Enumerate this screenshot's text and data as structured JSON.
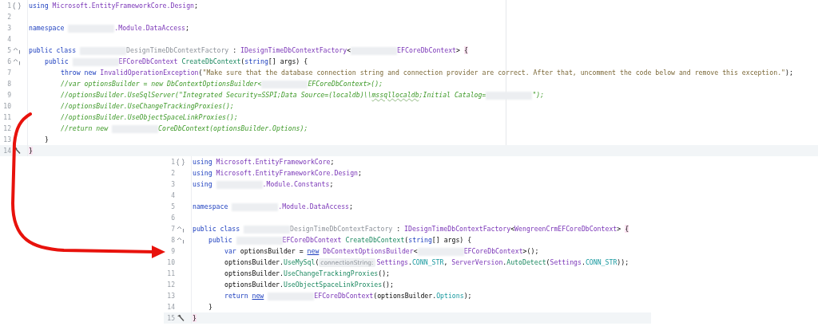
{
  "editors": [
    {
      "lines": [
        {
          "number": "1",
          "current": false,
          "kind": "braces",
          "tokens": [
            {
              "kind": "k",
              "text": "using "
            },
            {
              "kind": "t",
              "text": "Microsoft.EntityFrameworkCore.Design"
            },
            {
              "kind": "p",
              "text": ";"
            }
          ]
        },
        {
          "number": "2",
          "current": false
        },
        {
          "number": "3",
          "current": false,
          "tokens": [
            {
              "kind": "k",
              "text": "namespace "
            },
            {
              "kind": "r"
            },
            {
              "kind": "t",
              "text": ".Module.DataAccess"
            },
            {
              "kind": "p",
              "text": ";"
            }
          ]
        },
        {
          "number": "4",
          "current": false
        },
        {
          "number": "5",
          "current": false,
          "kind": "override",
          "tokens": [
            {
              "kind": "k",
              "text": "public class "
            },
            {
              "kind": "r"
            },
            {
              "kind": "g",
              "text": "DesignTimeDbContextFactory"
            },
            {
              "kind": "p",
              "text": " : "
            },
            {
              "kind": "t",
              "text": "IDesignTimeDbContextFactory"
            },
            {
              "kind": "p",
              "text": "<"
            },
            {
              "kind": "r"
            },
            {
              "kind": "t",
              "text": "EFCoreDbContext"
            },
            {
              "kind": "p",
              "text": "> "
            },
            {
              "kind": "b",
              "text": "{"
            }
          ]
        },
        {
          "number": "6",
          "current": false,
          "kind": "override",
          "tokens": [
            {
              "kind": "i"
            },
            {
              "kind": "k",
              "text": "public "
            },
            {
              "kind": "r"
            },
            {
              "kind": "t",
              "text": "EFCoreDbContext "
            },
            {
              "kind": "m",
              "text": "CreateDbContext"
            },
            {
              "kind": "p",
              "text": "("
            },
            {
              "kind": "k",
              "text": "string"
            },
            {
              "kind": "p",
              "text": "[] args) {"
            }
          ]
        },
        {
          "number": "7",
          "current": false,
          "tokens": [
            {
              "kind": "i"
            },
            {
              "kind": "i"
            },
            {
              "kind": "k",
              "text": "throw new "
            },
            {
              "kind": "t",
              "text": "InvalidOperationException"
            },
            {
              "kind": "p",
              "text": "("
            },
            {
              "kind": "s",
              "text": "\"Make sure that the database connection string and connection provider are correct. After that, uncomment the code below and remove this exception.\""
            },
            {
              "kind": "p",
              "text": ");"
            }
          ]
        },
        {
          "number": "8",
          "current": false,
          "tokens": [
            {
              "kind": "i"
            },
            {
              "kind": "i"
            },
            {
              "kind": "c",
              "text": "//var optionsBuilder = new DbContextOptionsBuilder<"
            },
            {
              "kind": "r"
            },
            {
              "kind": "c",
              "text": "EFCoreDbContext>();"
            }
          ]
        },
        {
          "number": "9",
          "current": false,
          "tokens": [
            {
              "kind": "i"
            },
            {
              "kind": "i"
            },
            {
              "kind": "c",
              "text": "//optionsBuilder.UseSqlServer(\"Integrated Security=SSPI;Data Source=(localdb)\\\\"
            },
            {
              "kind": "cs",
              "text": "mssqllocaldb"
            },
            {
              "kind": "c",
              "text": ";Initial Catalog="
            },
            {
              "kind": "r"
            },
            {
              "kind": "c",
              "text": "\");"
            }
          ]
        },
        {
          "number": "10",
          "current": false,
          "tokens": [
            {
              "kind": "i"
            },
            {
              "kind": "i"
            },
            {
              "kind": "c",
              "text": "//optionsBuilder.UseChangeTrackingProxies();"
            }
          ]
        },
        {
          "number": "11",
          "current": false,
          "tokens": [
            {
              "kind": "i"
            },
            {
              "kind": "i"
            },
            {
              "kind": "c",
              "text": "//optionsBuilder.UseObjectSpaceLinkProxies();"
            }
          ]
        },
        {
          "number": "12",
          "current": false,
          "tokens": [
            {
              "kind": "i"
            },
            {
              "kind": "i"
            },
            {
              "kind": "c",
              "text": "//return new "
            },
            {
              "kind": "r"
            },
            {
              "kind": "c",
              "text": "CoreDbContext(optionsBuilder.Options);"
            }
          ]
        },
        {
          "number": "13",
          "current": false,
          "tokens": [
            {
              "kind": "i"
            },
            {
              "kind": "p",
              "text": "}"
            }
          ]
        },
        {
          "number": "14",
          "current": true,
          "kind": "hammer",
          "tokens": [
            {
              "kind": "b",
              "text": "}"
            }
          ]
        }
      ]
    },
    {
      "lines": [
        {
          "number": "1",
          "current": false,
          "kind": "braces",
          "tokens": [
            {
              "kind": "k",
              "text": "using "
            },
            {
              "kind": "t",
              "text": "Microsoft.EntityFrameworkCore"
            },
            {
              "kind": "p",
              "text": ";"
            }
          ]
        },
        {
          "number": "2",
          "current": false,
          "tokens": [
            {
              "kind": "k",
              "text": "using "
            },
            {
              "kind": "t",
              "text": "Microsoft.EntityFrameworkCore.Design"
            },
            {
              "kind": "p",
              "text": ";"
            }
          ]
        },
        {
          "number": "3",
          "current": false,
          "tokens": [
            {
              "kind": "k",
              "text": "using "
            },
            {
              "kind": "r"
            },
            {
              "kind": "t",
              "text": ".Module.Constants"
            },
            {
              "kind": "p",
              "text": ";"
            }
          ]
        },
        {
          "number": "4",
          "current": false
        },
        {
          "number": "5",
          "current": false,
          "tokens": [
            {
              "kind": "k",
              "text": "namespace "
            },
            {
              "kind": "r"
            },
            {
              "kind": "t",
              "text": ".Module.DataAccess"
            },
            {
              "kind": "p",
              "text": ";"
            }
          ]
        },
        {
          "number": "6",
          "current": false
        },
        {
          "number": "7",
          "current": false,
          "kind": "override",
          "tokens": [
            {
              "kind": "k",
              "text": "public class "
            },
            {
              "kind": "r"
            },
            {
              "kind": "g",
              "text": "DesignTimeDbContextFactory"
            },
            {
              "kind": "p",
              "text": " : "
            },
            {
              "kind": "t",
              "text": "IDesignTimeDbContextFactory"
            },
            {
              "kind": "p",
              "text": "<"
            },
            {
              "kind": "t",
              "text": "WengreenCrmEFCoreDbContext"
            },
            {
              "kind": "p",
              "text": "> "
            },
            {
              "kind": "b",
              "text": "{"
            }
          ]
        },
        {
          "number": "8",
          "current": false,
          "kind": "override",
          "tokens": [
            {
              "kind": "i"
            },
            {
              "kind": "k",
              "text": "public "
            },
            {
              "kind": "r"
            },
            {
              "kind": "t",
              "text": "EFCoreDbContext "
            },
            {
              "kind": "m",
              "text": "CreateDbContext"
            },
            {
              "kind": "p",
              "text": "("
            },
            {
              "kind": "k",
              "text": "string"
            },
            {
              "kind": "p",
              "text": "[] args) {"
            }
          ]
        },
        {
          "number": "9",
          "current": false,
          "tokens": [
            {
              "kind": "i"
            },
            {
              "kind": "i"
            },
            {
              "kind": "k",
              "text": "var "
            },
            {
              "kind": "p",
              "text": "optionsBuilder = "
            },
            {
              "kind": "u",
              "text": "new"
            },
            {
              "kind": "sp"
            },
            {
              "kind": "t",
              "text": "DbContextOptionsBuilder"
            },
            {
              "kind": "p",
              "text": "<"
            },
            {
              "kind": "r"
            },
            {
              "kind": "t",
              "text": "EFCoreDbContext"
            },
            {
              "kind": "p",
              "text": ">();"
            }
          ]
        },
        {
          "number": "10",
          "current": false,
          "tokens": [
            {
              "kind": "i"
            },
            {
              "kind": "i"
            },
            {
              "kind": "p",
              "text": "optionsBuilder."
            },
            {
              "kind": "m",
              "text": "UseMySql"
            },
            {
              "kind": "p",
              "text": "("
            },
            {
              "kind": "h",
              "text": "connectionString:"
            },
            {
              "kind": "t",
              "text": "Settings"
            },
            {
              "kind": "p",
              "text": "."
            },
            {
              "kind": "f",
              "text": "CONN_STR"
            },
            {
              "kind": "p",
              "text": ", "
            },
            {
              "kind": "t",
              "text": "ServerVersion"
            },
            {
              "kind": "p",
              "text": "."
            },
            {
              "kind": "m",
              "text": "AutoDetect"
            },
            {
              "kind": "p",
              "text": "("
            },
            {
              "kind": "t",
              "text": "Settings"
            },
            {
              "kind": "p",
              "text": "."
            },
            {
              "kind": "f",
              "text": "CONN_STR"
            },
            {
              "kind": "p",
              "text": "));"
            }
          ]
        },
        {
          "number": "11",
          "current": false,
          "tokens": [
            {
              "kind": "i"
            },
            {
              "kind": "i"
            },
            {
              "kind": "p",
              "text": "optionsBuilder."
            },
            {
              "kind": "m",
              "text": "UseChangeTrackingProxies"
            },
            {
              "kind": "p",
              "text": "();"
            }
          ]
        },
        {
          "number": "12",
          "current": false,
          "tokens": [
            {
              "kind": "i"
            },
            {
              "kind": "i"
            },
            {
              "kind": "p",
              "text": "optionsBuilder."
            },
            {
              "kind": "m",
              "text": "UseObjectSpaceLinkProxies"
            },
            {
              "kind": "p",
              "text": "();"
            }
          ]
        },
        {
          "number": "13",
          "current": false,
          "tokens": [
            {
              "kind": "i"
            },
            {
              "kind": "i"
            },
            {
              "kind": "k",
              "text": "return "
            },
            {
              "kind": "u",
              "text": "new"
            },
            {
              "kind": "sp"
            },
            {
              "kind": "r"
            },
            {
              "kind": "t",
              "text": "EFCoreDbContext"
            },
            {
              "kind": "p",
              "text": "(optionsBuilder."
            },
            {
              "kind": "f",
              "text": "Options"
            },
            {
              "kind": "p",
              "text": ");"
            }
          ]
        },
        {
          "number": "14",
          "current": false,
          "tokens": [
            {
              "kind": "i"
            },
            {
              "kind": "p",
              "text": "}"
            }
          ]
        },
        {
          "number": "15",
          "current": true,
          "kind": "hammer",
          "tokens": [
            {
              "kind": "b",
              "text": "}"
            }
          ]
        }
      ]
    }
  ]
}
